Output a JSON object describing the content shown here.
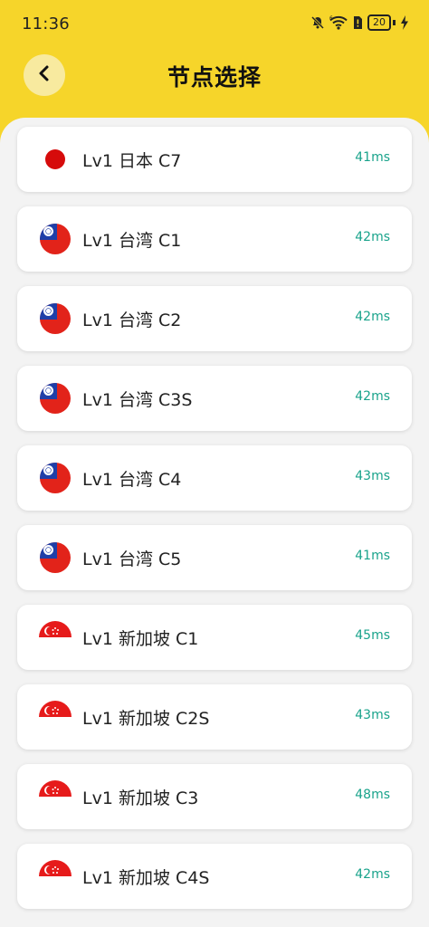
{
  "status_bar": {
    "time": "11:36",
    "battery_level": "20",
    "icons": [
      "mute-bell-icon",
      "wifi-icon",
      "sim-alert-icon",
      "battery-icon",
      "charging-bolt-icon"
    ]
  },
  "header": {
    "title": "节点选择",
    "back_icon": "chevron-left-icon"
  },
  "colors": {
    "header_bg": "#f6d52a",
    "latency_text": "#19a38b"
  },
  "nodes": [
    {
      "name": "Lv1 日本 C7",
      "latency": "41ms",
      "flag": "japan-flag-icon"
    },
    {
      "name": "Lv1 台湾 C1",
      "latency": "42ms",
      "flag": "taiwan-flag-icon"
    },
    {
      "name": "Lv1 台湾 C2",
      "latency": "42ms",
      "flag": "taiwan-flag-icon"
    },
    {
      "name": "Lv1 台湾 C3S",
      "latency": "42ms",
      "flag": "taiwan-flag-icon"
    },
    {
      "name": "Lv1 台湾 C4",
      "latency": "43ms",
      "flag": "taiwan-flag-icon"
    },
    {
      "name": "Lv1 台湾 C5",
      "latency": "41ms",
      "flag": "taiwan-flag-icon"
    },
    {
      "name": "Lv1 新加坡 C1",
      "latency": "45ms",
      "flag": "singapore-flag-icon"
    },
    {
      "name": "Lv1 新加坡 C2S",
      "latency": "43ms",
      "flag": "singapore-flag-icon"
    },
    {
      "name": "Lv1 新加坡 C3",
      "latency": "48ms",
      "flag": "singapore-flag-icon"
    },
    {
      "name": "Lv1 新加坡 C4S",
      "latency": "42ms",
      "flag": "singapore-flag-icon"
    }
  ]
}
